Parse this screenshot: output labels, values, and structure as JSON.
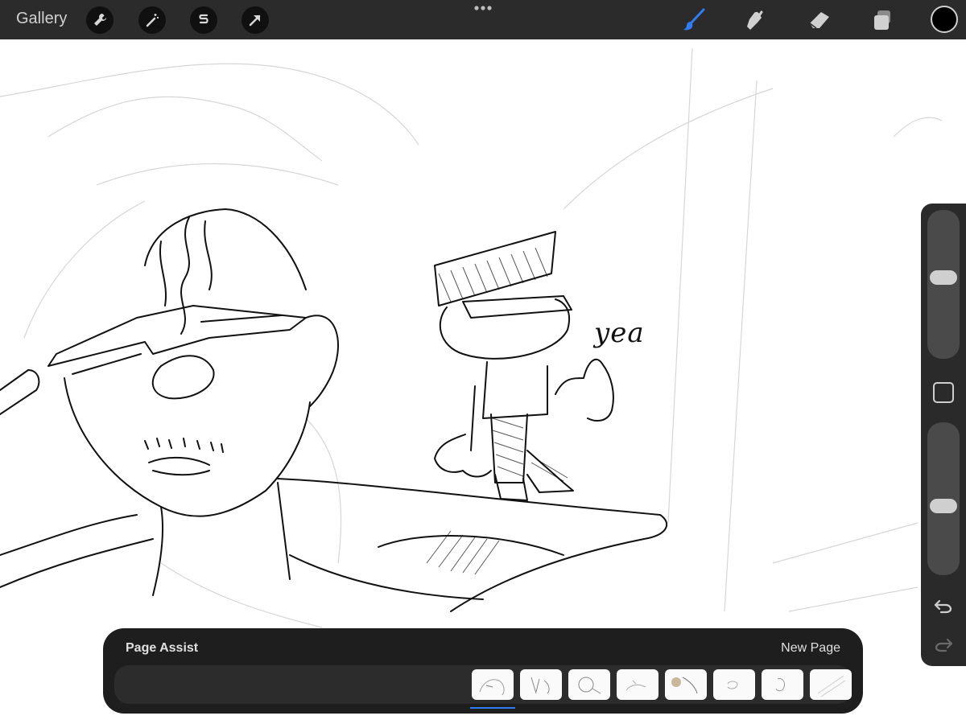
{
  "toolbar": {
    "gallery_label": "Gallery",
    "left_tools": [
      "wrench-icon",
      "magic-wand-icon",
      "selection-icon",
      "transform-arrow-icon"
    ],
    "right_tools": [
      "brush-icon",
      "smudge-icon",
      "eraser-icon",
      "layers-icon"
    ],
    "active_tool": "brush-icon",
    "active_color": "#000000",
    "accent": "#2f7df6"
  },
  "canvas": {
    "annotation_text": "yea"
  },
  "sidebar": {
    "brush_size_level": 0.55,
    "opacity_level": 0.45,
    "buttons": [
      "modify-square-icon",
      "undo-icon",
      "redo-icon"
    ]
  },
  "page_assist": {
    "title": "Page Assist",
    "new_page_label": "New Page",
    "page_count": 8,
    "active_page_index": 0
  }
}
